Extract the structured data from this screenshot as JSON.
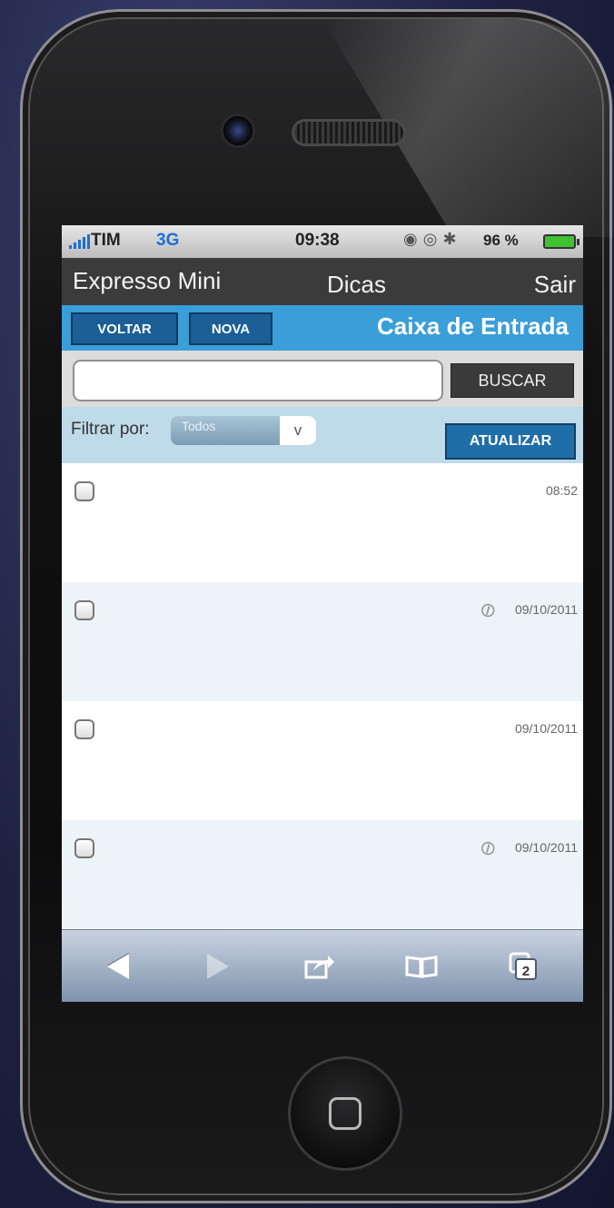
{
  "status_bar": {
    "carrier": "TIM",
    "network": "3G",
    "time": "09:38",
    "battery_percent": "96 %",
    "icons": [
      "signal-bars-icon",
      "rotation-lock-icon",
      "alarm-icon",
      "bluetooth-icon",
      "battery-icon"
    ]
  },
  "app_bar": {
    "title": "Expresso Mini",
    "tips_label": "Dicas",
    "logout_label": "Sair"
  },
  "nav_bar": {
    "back_label": "VOLTAR",
    "new_label": "NOVA",
    "folder_title": "Caixa de Entrada"
  },
  "search": {
    "value": "",
    "button_label": "BUSCAR"
  },
  "filter": {
    "label": "Filtrar por:",
    "selected": "Todos",
    "chevron": "v",
    "refresh_label": "ATUALIZAR"
  },
  "messages": [
    {
      "subject": "",
      "sender": "",
      "preview": "",
      "date": "08:52",
      "attachment": false
    },
    {
      "subject": "",
      "sender": "",
      "preview": "",
      "date": "09/10/2011",
      "attachment": true
    },
    {
      "subject": "",
      "sender": "",
      "preview": "",
      "date": "09/10/2011",
      "attachment": false
    },
    {
      "subject": "",
      "sender": "",
      "preview": "",
      "date": "09/10/2011",
      "attachment": true
    }
  ],
  "browser_toolbar": {
    "tabs_count": "2",
    "icons": [
      "back-arrow-icon",
      "forward-arrow-icon",
      "share-icon",
      "bookmarks-icon",
      "tabs-icon"
    ]
  },
  "colors": {
    "blue_bar": "#3a9ed8",
    "app_bar": "#3b3b3b",
    "filter_bar": "#bfdae8",
    "button_dark_blue": "#1b5f96"
  }
}
